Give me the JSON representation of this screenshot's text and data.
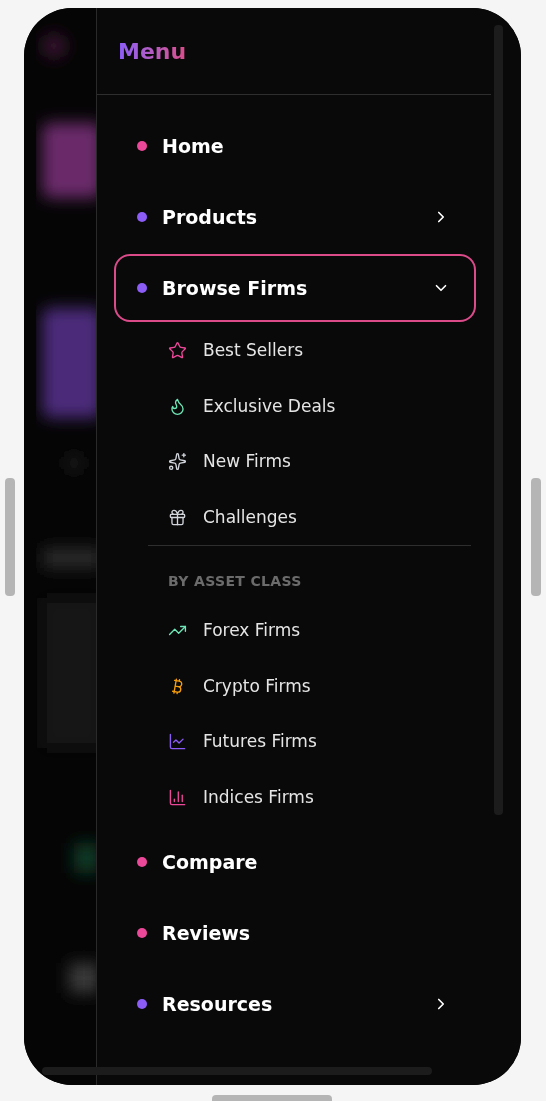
{
  "menu": {
    "title": "Menu",
    "items": [
      {
        "label": "Home",
        "kind": "link",
        "color": "#ec4899",
        "selected": false
      },
      {
        "label": "Products",
        "kind": "submenu",
        "color": "#8b5cf6",
        "selected": false,
        "expanded": false
      },
      {
        "label": "Browse Firms",
        "kind": "submenu",
        "color": "#8b5cf6",
        "selected": true,
        "expanded": true,
        "children": [
          {
            "items": [
              {
                "label": "Best Sellers"
              },
              {
                "label": "Exclusive Deals"
              },
              {
                "label": "New Firms"
              },
              {
                "label": "Challenges"
              }
            ]
          },
          {
            "heading": "BY ASSET CLASS",
            "items": [
              {
                "label": "Forex Firms"
              },
              {
                "label": "Crypto Firms"
              },
              {
                "label": "Futures Firms"
              },
              {
                "label": "Indices Firms"
              }
            ]
          }
        ]
      },
      {
        "label": "Compare",
        "kind": "link",
        "color": "#ec4899",
        "selected": false
      },
      {
        "label": "Reviews",
        "kind": "link",
        "color": "#ec4899",
        "selected": false
      },
      {
        "label": "Resources",
        "kind": "submenu",
        "color": "#8b5cf6",
        "selected": false,
        "expanded": false
      }
    ]
  }
}
